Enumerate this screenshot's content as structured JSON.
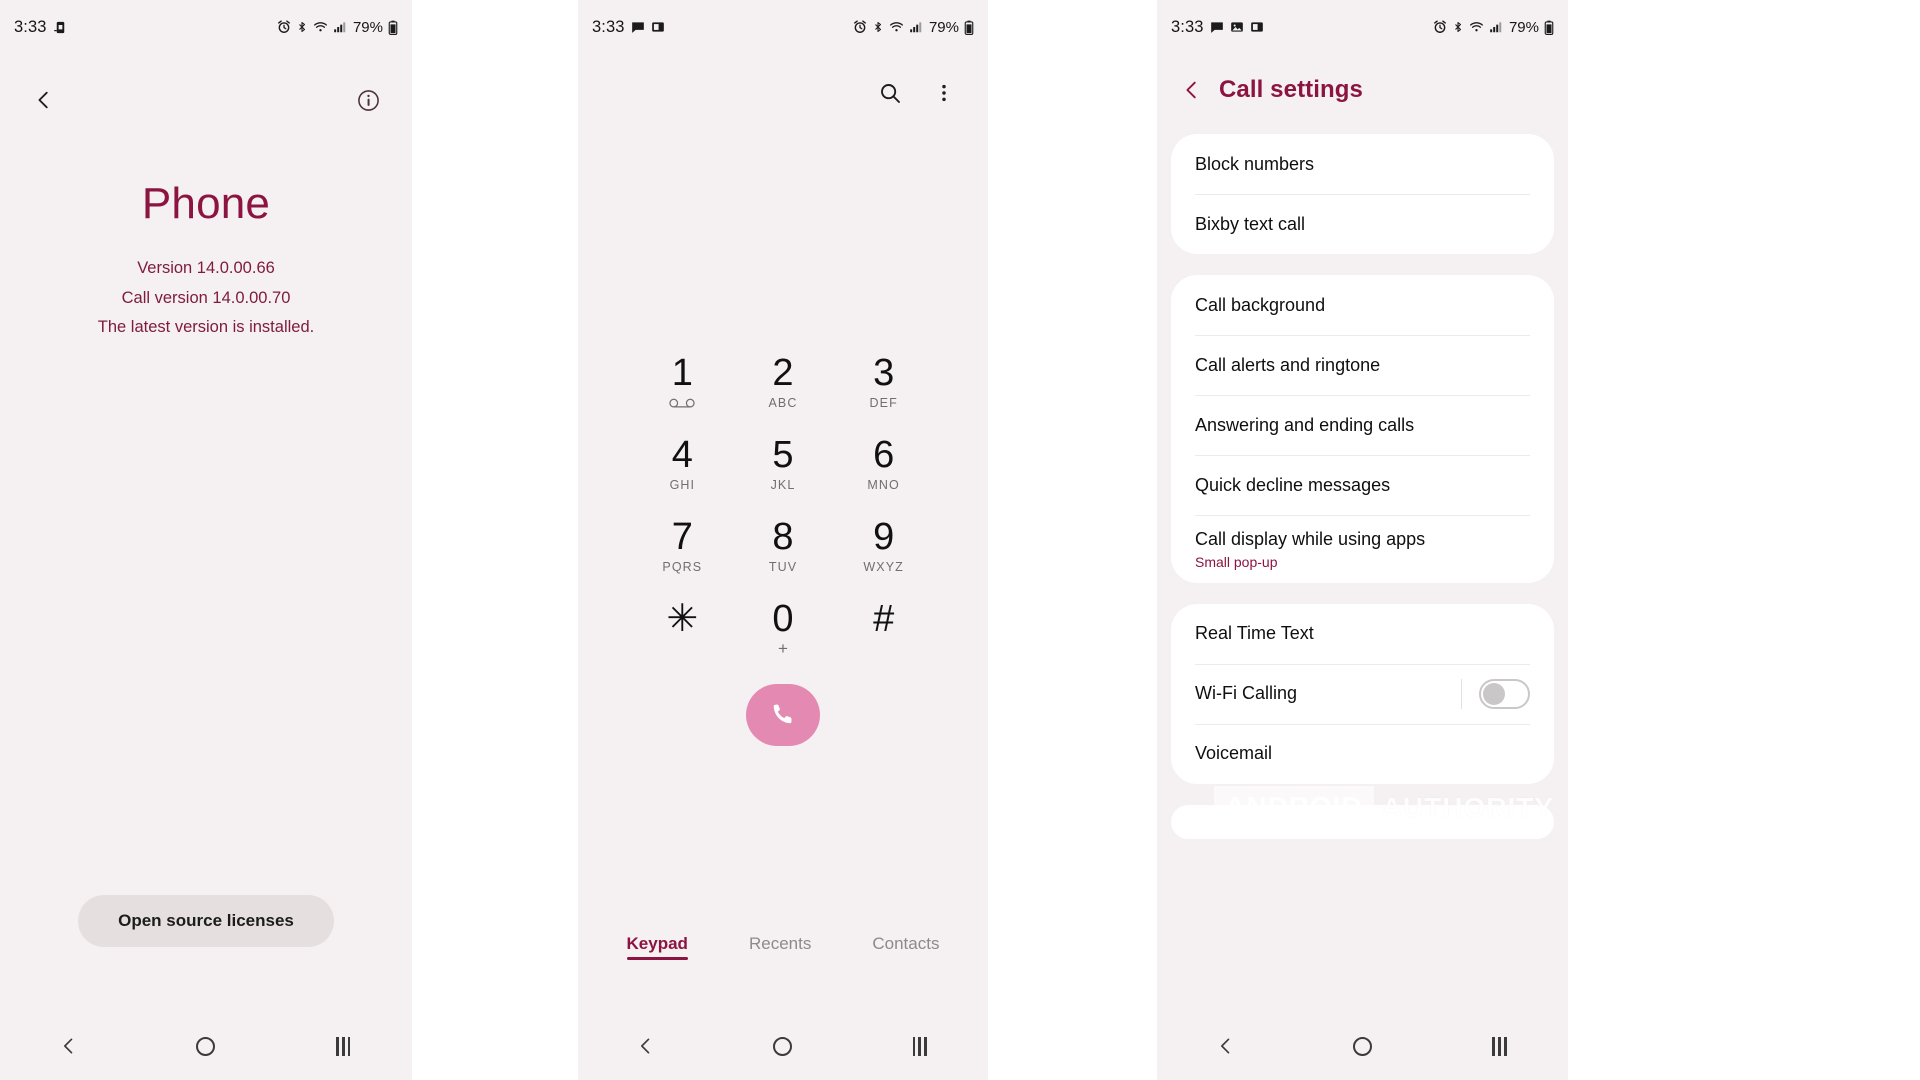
{
  "colors": {
    "accent_maroon": "#8c1441",
    "panel_background": "#f5f0f1",
    "card_white": "#ffffff",
    "call_button_pink": "#e48ab2",
    "oss_button_gray": "#e6dfe0",
    "muted_text": "#8b8b8b"
  },
  "status_bar": {
    "time": "3:33",
    "battery_percent": "79%",
    "left_icons": [
      "sim-card-icon"
    ],
    "right_icons": [
      "alarm-icon",
      "bluetooth-icon",
      "wifi-icon",
      "signal-icon",
      "battery-icon"
    ]
  },
  "status_bar_keypad": {
    "time": "3:33",
    "battery_percent": "79%",
    "left_icons": [
      "message-icon",
      "screenshot-icon"
    ],
    "right_icons": [
      "alarm-icon",
      "bluetooth-icon",
      "wifi-icon",
      "signal-icon",
      "battery-icon"
    ]
  },
  "status_bar_settings": {
    "time": "3:33",
    "battery_percent": "79%",
    "left_icons": [
      "message-icon",
      "image-icon",
      "screenshot-icon"
    ],
    "right_icons": [
      "alarm-icon",
      "bluetooth-icon",
      "wifi-icon",
      "signal-icon",
      "battery-icon"
    ]
  },
  "about": {
    "back_icon": "back-arrow-icon",
    "info_icon": "info-circle-icon",
    "app_name": "Phone",
    "version": "Version 14.0.00.66",
    "call_version": "Call version 14.0.00.70",
    "update_status": "The latest version is installed.",
    "open_source_button": "Open source licenses"
  },
  "keypad": {
    "search_icon": "search-icon",
    "more_icon": "more-vertical-icon",
    "call_icon": "phone-call-icon",
    "keys": [
      {
        "digit": "1",
        "sub": "",
        "icon": "voicemail-icon"
      },
      {
        "digit": "2",
        "sub": "ABC",
        "icon": ""
      },
      {
        "digit": "3",
        "sub": "DEF",
        "icon": ""
      },
      {
        "digit": "4",
        "sub": "GHI",
        "icon": ""
      },
      {
        "digit": "5",
        "sub": "JKL",
        "icon": ""
      },
      {
        "digit": "6",
        "sub": "MNO",
        "icon": ""
      },
      {
        "digit": "7",
        "sub": "PQRS",
        "icon": ""
      },
      {
        "digit": "8",
        "sub": "TUV",
        "icon": ""
      },
      {
        "digit": "9",
        "sub": "WXYZ",
        "icon": ""
      },
      {
        "digit": "✳",
        "sub": "",
        "icon": ""
      },
      {
        "digit": "0",
        "sub": "+",
        "icon": ""
      },
      {
        "digit": "#",
        "sub": "",
        "icon": ""
      }
    ],
    "tabs": [
      {
        "label": "Keypad",
        "active": true
      },
      {
        "label": "Recents",
        "active": false
      },
      {
        "label": "Contacts",
        "active": false
      }
    ]
  },
  "call_settings": {
    "back_icon": "back-arrow-icon",
    "title": "Call settings",
    "groups": [
      {
        "rows": [
          {
            "label": "Block numbers",
            "sub": "",
            "control": "none"
          },
          {
            "label": "Bixby text call",
            "sub": "",
            "control": "none"
          }
        ]
      },
      {
        "rows": [
          {
            "label": "Call background",
            "sub": "",
            "control": "none"
          },
          {
            "label": "Call alerts and ringtone",
            "sub": "",
            "control": "none"
          },
          {
            "label": "Answering and ending calls",
            "sub": "",
            "control": "none"
          },
          {
            "label": "Quick decline messages",
            "sub": "",
            "control": "none"
          },
          {
            "label": "Call display while using apps",
            "sub": "Small pop-up",
            "control": "none"
          }
        ]
      },
      {
        "rows": [
          {
            "label": "Real Time Text",
            "sub": "",
            "control": "none"
          },
          {
            "label": "Wi-Fi Calling",
            "sub": "",
            "control": "toggle-off"
          },
          {
            "label": "Voicemail",
            "sub": "",
            "control": "none"
          }
        ]
      }
    ]
  },
  "nav_bar": {
    "back_icon": "nav-back-icon",
    "home_icon": "nav-home-icon",
    "recents_icon": "nav-recents-icon"
  },
  "watermark": {
    "word_one": "ANDROID",
    "word_two": "AUTHORITY"
  }
}
